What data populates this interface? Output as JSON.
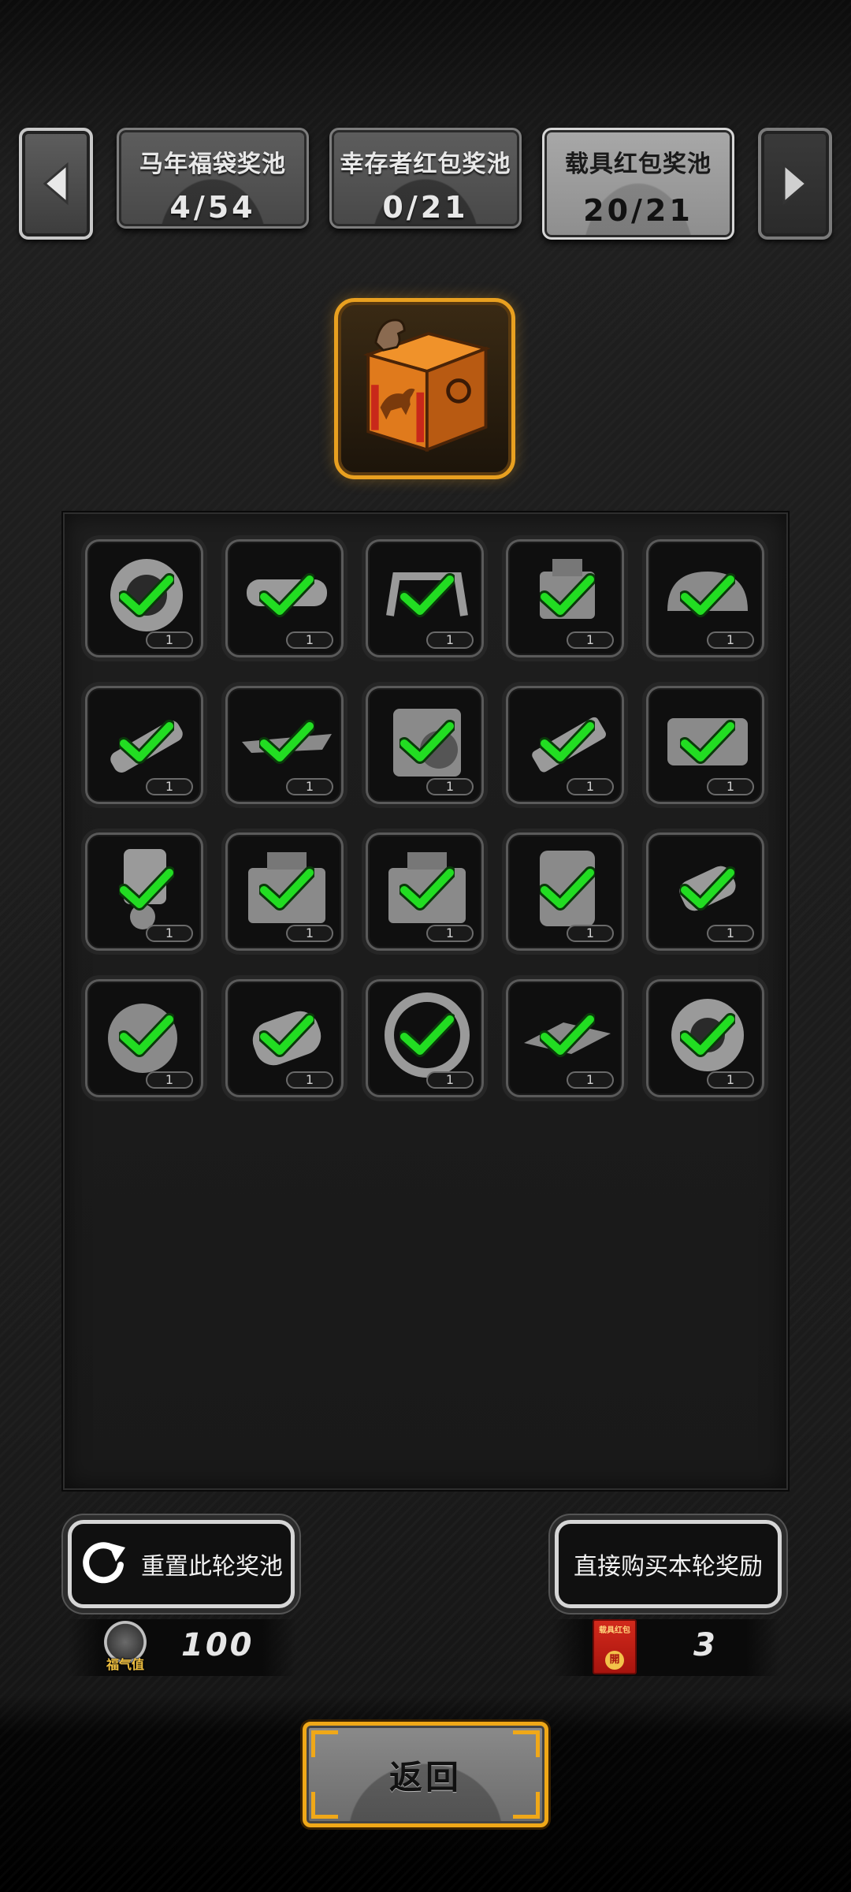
{
  "tabs": [
    {
      "title": "马年福袋奖池",
      "count": "4/54",
      "active": false
    },
    {
      "title": "幸存者红包奖池",
      "count": "0/21",
      "active": false
    },
    {
      "title": "载具红包奖池",
      "count": "20/21",
      "active": true
    }
  ],
  "icons": {
    "prev": "chevron-left-icon",
    "next": "chevron-right-icon",
    "chest": "horse-chest-icon",
    "check": "green-check-icon",
    "reset": "refresh-icon",
    "fortune": "fortune-coin-icon",
    "envelope": "red-envelope-icon"
  },
  "rewards": [
    {
      "name": "tire",
      "qty": "1",
      "collected": true
    },
    {
      "name": "bumper",
      "qty": "1",
      "collected": true
    },
    {
      "name": "roll-cage",
      "qty": "1",
      "collected": true
    },
    {
      "name": "engine-part",
      "qty": "1",
      "collected": true
    },
    {
      "name": "car-body",
      "qty": "1",
      "collected": true
    },
    {
      "name": "exhaust",
      "qty": "1",
      "collected": true
    },
    {
      "name": "spoiler",
      "qty": "1",
      "collected": true
    },
    {
      "name": "engine-block",
      "qty": "1",
      "collected": true
    },
    {
      "name": "muffler",
      "qty": "1",
      "collected": true
    },
    {
      "name": "v8-engine",
      "qty": "1",
      "collected": true
    },
    {
      "name": "piston",
      "qty": "1",
      "collected": true
    },
    {
      "name": "toolbox",
      "qty": "1",
      "collected": true
    },
    {
      "name": "toolbox-large",
      "qty": "1",
      "collected": true
    },
    {
      "name": "motor",
      "qty": "1",
      "collected": true
    },
    {
      "name": "driveshaft",
      "qty": "1",
      "collected": true
    },
    {
      "name": "turbo",
      "qty": "1",
      "collected": true
    },
    {
      "name": "cylinder",
      "qty": "1",
      "collected": true
    },
    {
      "name": "chain-wheel",
      "qty": "1",
      "collected": true
    },
    {
      "name": "chassis-frame",
      "qty": "1",
      "collected": true
    },
    {
      "name": "motorcycle-tire",
      "qty": "1",
      "collected": true
    }
  ],
  "actions": {
    "reset_label": "重置此轮奖池",
    "buy_label": "直接购买本轮奖励",
    "back_label": "返回"
  },
  "currencies": {
    "fortune_label": "福气值",
    "fortune_value": "100",
    "envelope_label": "载具红包",
    "envelope_seal": "開",
    "envelope_value": "3"
  },
  "colors": {
    "accent_gold": "#f0a818",
    "check_green": "#22dd22"
  }
}
